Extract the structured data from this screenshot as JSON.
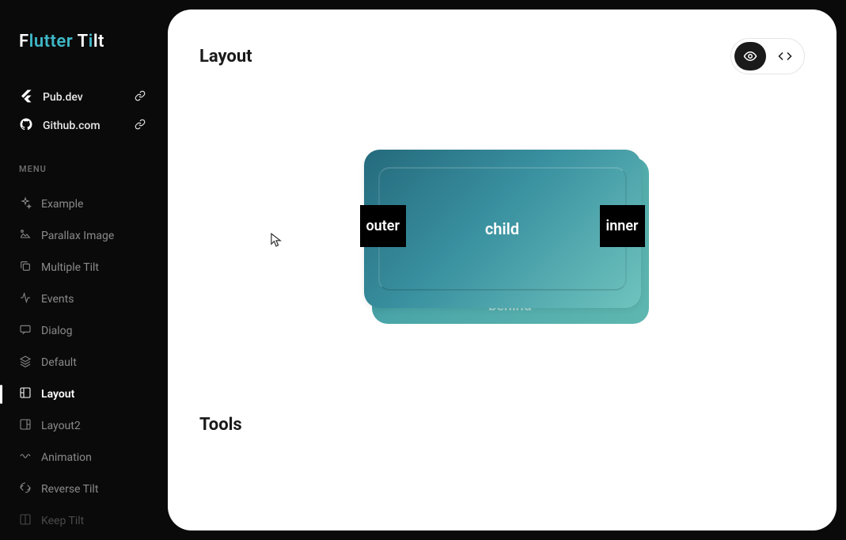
{
  "brand": {
    "part1": "F",
    "part2": "lutter ",
    "part3": "T",
    "part4": "i",
    "part5": "lt"
  },
  "links": [
    {
      "label": "Pub.dev"
    },
    {
      "label": "Github.com"
    }
  ],
  "menu_header": "MENU",
  "menu": [
    {
      "label": "Example"
    },
    {
      "label": "Parallax Image"
    },
    {
      "label": "Multiple Tilt"
    },
    {
      "label": "Events"
    },
    {
      "label": "Dialog"
    },
    {
      "label": "Default"
    },
    {
      "label": "Layout"
    },
    {
      "label": "Layout2"
    },
    {
      "label": "Animation"
    },
    {
      "label": "Reverse Tilt"
    },
    {
      "label": "Keep Tilt"
    }
  ],
  "sections": {
    "layout": {
      "title": "Layout"
    },
    "tools": {
      "title": "Tools"
    }
  },
  "demo": {
    "outer": "outer",
    "child": "child",
    "inner": "inner",
    "behind": "behind"
  }
}
